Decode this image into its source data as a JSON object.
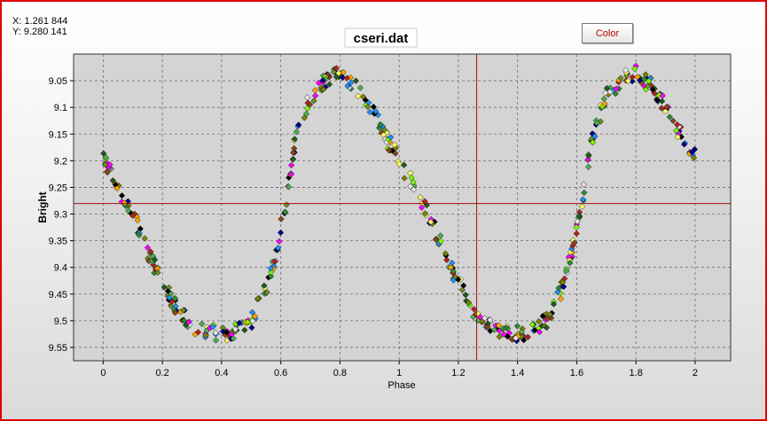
{
  "readout": {
    "x": "X: 1.261 844",
    "y": "Y: 9.280 141"
  },
  "buttons": {
    "color_label": "Color"
  },
  "colors": {
    "frame_border": "#e00000",
    "cursor_line": "#a01010",
    "grid": "#6e6e6e",
    "marker_palette": [
      "#1f5a1f",
      "#2e8b2e",
      "#4caf50",
      "#6b8e23",
      "#808000",
      "#8b4513",
      "#b22222",
      "#ff00ff",
      "#ffff66",
      "#e6e6e6",
      "#1e90ff",
      "#00008b",
      "#ffa500",
      "#000000",
      "#7cfc00"
    ]
  },
  "chart_data": {
    "type": "scatter",
    "title": "cseri.dat",
    "xlabel": "Phase",
    "ylabel": "Bright",
    "xlim": [
      -0.1,
      2.12
    ],
    "ylim": [
      9.575,
      9.0
    ],
    "y_inverted": true,
    "grid": true,
    "x_ticks": [
      "0",
      "0.2",
      "0.4",
      "0.6",
      "0.8",
      "1",
      "1.2",
      "1.4",
      "1.6",
      "1.8",
      "2"
    ],
    "x_tick_values": [
      0,
      0.2,
      0.4,
      0.6,
      0.8,
      1,
      1.2,
      1.4,
      1.6,
      1.8,
      2
    ],
    "y_ticks": [
      "9.05",
      "9.1",
      "9.15",
      "9.2",
      "9.25",
      "9.3",
      "9.35",
      "9.4",
      "9.45",
      "9.5",
      "9.55"
    ],
    "y_tick_values": [
      9.05,
      9.1,
      9.15,
      9.2,
      9.25,
      9.3,
      9.35,
      9.4,
      9.45,
      9.5,
      9.55
    ],
    "cursor": {
      "x": 1.261844,
      "y": 9.280141
    },
    "light_curve": {
      "phase": [
        0.0,
        0.05,
        0.1,
        0.15,
        0.2,
        0.25,
        0.3,
        0.35,
        0.4,
        0.45,
        0.5,
        0.55,
        0.58,
        0.62,
        0.65,
        0.7,
        0.75,
        0.8,
        0.85,
        0.9,
        0.95,
        1.0,
        1.05,
        1.1,
        1.15,
        1.2,
        1.25,
        1.3,
        1.35,
        1.4,
        1.45,
        1.5,
        1.55,
        1.58,
        1.62,
        1.65,
        1.7,
        1.75,
        1.8,
        1.85,
        1.9,
        1.95,
        2.0
      ],
      "magnitude": [
        9.2,
        9.25,
        9.3,
        9.37,
        9.43,
        9.48,
        9.51,
        9.52,
        9.525,
        9.52,
        9.5,
        9.44,
        9.38,
        9.27,
        9.16,
        9.08,
        9.05,
        9.035,
        9.06,
        9.1,
        9.15,
        9.2,
        9.25,
        9.3,
        9.37,
        9.43,
        9.48,
        9.51,
        9.52,
        9.525,
        9.52,
        9.5,
        9.44,
        9.38,
        9.27,
        9.16,
        9.08,
        9.05,
        9.035,
        9.06,
        9.1,
        9.15,
        9.19
      ]
    },
    "n_points": 520,
    "scatter_mag": 0.022
  }
}
